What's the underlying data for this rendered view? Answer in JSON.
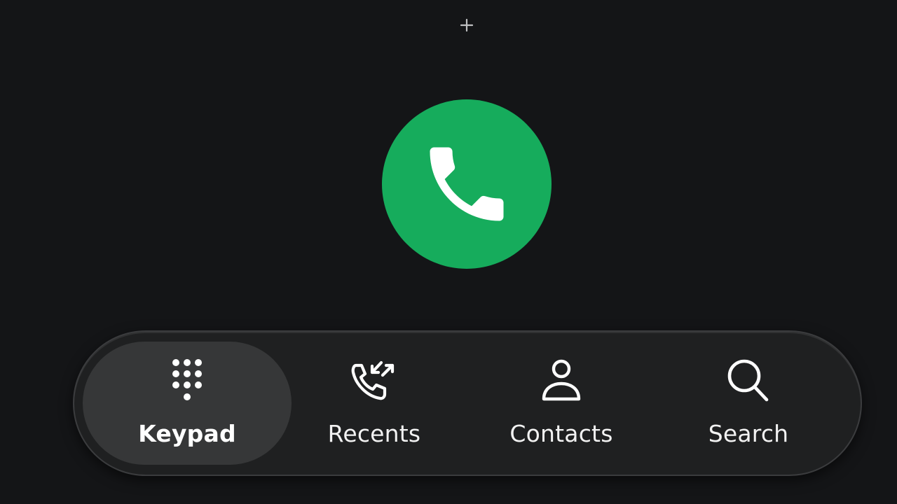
{
  "header": {
    "add_icon": "plus-icon"
  },
  "call": {
    "icon": "phone-icon",
    "color": "#16ac5c"
  },
  "nav": {
    "items": [
      {
        "label": "Keypad",
        "icon": "dialpad-icon",
        "active": true
      },
      {
        "label": "Recents",
        "icon": "recent-calls-icon",
        "active": false
      },
      {
        "label": "Contacts",
        "icon": "person-icon",
        "active": false
      },
      {
        "label": "Search",
        "icon": "search-icon",
        "active": false
      }
    ]
  }
}
